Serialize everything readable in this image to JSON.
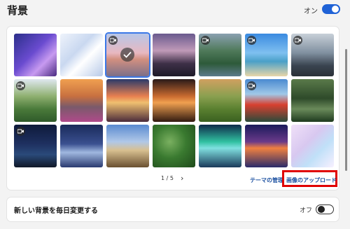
{
  "header": {
    "title": "背景",
    "toggle_label": "オン",
    "toggle_state": "on"
  },
  "gallery": {
    "tiles": [
      {
        "name": "purple-flower",
        "bg": "linear-gradient(135deg,#2b2f8a 0%,#6a4bd0 45%,#c79af0 70%,#4a2a80 100%)",
        "video": false,
        "selected": false
      },
      {
        "name": "white-fabric",
        "bg": "linear-gradient(135deg,#eef3fb 0%,#c9d8f0 40%,#ffffff 60%,#b7c9e8 100%)",
        "video": false,
        "selected": false
      },
      {
        "name": "sunset-pier",
        "bg": "linear-gradient(180deg,#b7c7e8 0%,#e8b8c0 45%,#d29080 60%,#7b6f88 100%)",
        "video": true,
        "selected": true
      },
      {
        "name": "mountain-lake-dusk",
        "bg": "linear-gradient(180deg,#6a5a8e 0%,#c09ab8 40%,#3e3048 70%,#1d1a28 100%)",
        "video": false,
        "selected": false
      },
      {
        "name": "green-valley-river",
        "bg": "linear-gradient(180deg,#8aa0b0 0%,#4f7a5a 40%,#2e5a3a 70%,#5c7a8a 100%)",
        "video": true,
        "selected": false
      },
      {
        "name": "beach-blue-sky",
        "bg": "linear-gradient(180deg,#3a8ae0 0%,#7fc0f0 45%,#4aa0c8 65%,#e8d6a8 100%)",
        "video": true,
        "selected": false
      },
      {
        "name": "misty-mountains",
        "bg": "linear-gradient(180deg,#c8d0d8 0%,#8090a0 45%,#3a4450 75%,#2a3038 100%)",
        "video": true,
        "selected": false
      },
      {
        "name": "green-peaks",
        "bg": "linear-gradient(180deg,#dfe8f0 0%,#8fb070 40%,#4a7a3a 70%,#2f5a2a 100%)",
        "video": true,
        "selected": false
      },
      {
        "name": "sunset-flowers",
        "bg": "linear-gradient(180deg,#f0a050 0%,#c87040 40%,#7a5a6a 65%,#b04a8a 100%)",
        "video": false,
        "selected": false
      },
      {
        "name": "sunset-reflection",
        "bg": "linear-gradient(180deg,#2a3a6a 0%,#e88050 40%,#f0c070 55%,#4a2a3a 100%)",
        "video": false,
        "selected": false
      },
      {
        "name": "sea-cave-sunset",
        "bg": "linear-gradient(180deg,#2a1a18 0%,#c86a30 40%,#f0a050 55%,#301a10 100%)",
        "video": false,
        "selected": false
      },
      {
        "name": "rice-terraces",
        "bg": "linear-gradient(180deg,#d0a060 0%,#8aa050 40%,#5a8030 70%,#3a6020 100%)",
        "video": false,
        "selected": false
      },
      {
        "name": "mount-fuji-pagoda",
        "bg": "linear-gradient(180deg,#4a8ad0 0%,#a0c8e8 35%,#d84030 60%,#2a4a3a 100%)",
        "video": true,
        "selected": false
      },
      {
        "name": "forest-waterfall",
        "bg": "linear-gradient(180deg,#5a7a4a 0%,#2e4a2a 45%,#6a8a5a 70%,#1e3a1e 100%)",
        "video": false,
        "selected": false
      },
      {
        "name": "starry-sky",
        "bg": "linear-gradient(180deg,#0e1a3a 0%,#1e3060 45%,#2a4a7a 70%,#101828 100%)",
        "video": true,
        "selected": false
      },
      {
        "name": "night-lake-stars",
        "bg": "linear-gradient(180deg,#1a2a5a 0%,#3a5090 45%,#a0b8e0 65%,#2a3a70 100%)",
        "video": false,
        "selected": false
      },
      {
        "name": "desert-cactus",
        "bg": "linear-gradient(180deg,#5a8ad0 0%,#b0c8e8 40%,#d8c090 60%,#6a5030 100%)",
        "video": false,
        "selected": false
      },
      {
        "name": "green-foliage",
        "bg": "radial-gradient(circle at 40% 40%,#7ab060 0%,#3a7a30 45%,#1e4a1a 100%)",
        "video": false,
        "selected": false
      },
      {
        "name": "aurora",
        "bg": "linear-gradient(180deg,#0e2a4a 0%,#30c0a0 40%,#80e0e0 55%,#1a3a5a 100%)",
        "video": false,
        "selected": false
      },
      {
        "name": "lake-sunset-purple",
        "bg": "linear-gradient(180deg,#1a1a5a 0%,#6a3a8a 40%,#f08040 55%,#2a2a6a 100%)",
        "video": false,
        "selected": false
      },
      {
        "name": "pastel-waves",
        "bg": "linear-gradient(135deg,#f0e0f8 0%,#d8c8f0 40%,#c0e0f8 65%,#f8f0ff 100%)",
        "video": false,
        "selected": false
      }
    ],
    "pager": "1 / 5",
    "next_glyph": "›",
    "manage_label": "テーマの管理",
    "upload_label": "画像のアップロード",
    "highlight_color": "#e00000"
  },
  "daily": {
    "label": "新しい背景を毎日変更する",
    "toggle_label": "オフ",
    "toggle_state": "off"
  },
  "colors": {
    "accent": "#1f62d6",
    "link": "#1a4fa0"
  }
}
